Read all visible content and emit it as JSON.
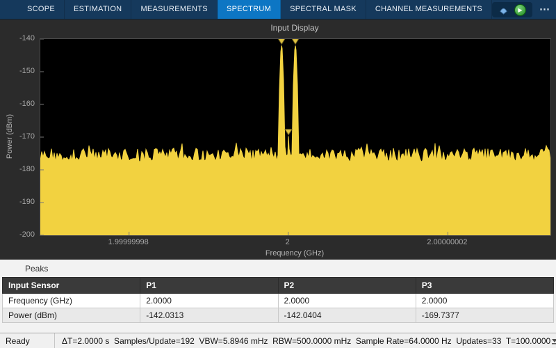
{
  "toolbar": {
    "tabs": [
      {
        "label": "SCOPE",
        "active": false
      },
      {
        "label": "ESTIMATION",
        "active": false
      },
      {
        "label": "MEASUREMENTS",
        "active": false
      },
      {
        "label": "SPECTRUM",
        "active": true
      },
      {
        "label": "SPECTRAL MASK",
        "active": false
      },
      {
        "label": "CHANNEL MEASUREMENTS",
        "active": false
      }
    ],
    "run_glyph": "▶",
    "more_glyph": "⋯",
    "accent_color": "#0d76c4",
    "bar_color": "#15395c"
  },
  "chart_data": {
    "type": "line",
    "title": "Input Display",
    "xlabel": "Frequency (GHz)",
    "ylabel": "Power (dBm)",
    "ylim": [
      -200,
      -140
    ],
    "y_ticks": [
      "-140",
      "-150",
      "-160",
      "-170",
      "-180",
      "-190",
      "-200"
    ],
    "x_ticks": [
      {
        "label": "1.99999998",
        "rel": 0.174
      },
      {
        "label": "2",
        "rel": 0.486
      },
      {
        "label": "2.00000002",
        "rel": 0.799
      }
    ],
    "noise_floor_dbm": -176,
    "peaks": [
      {
        "id": "P1",
        "freq_ghz": "2.0000",
        "power_dbm": -142.0313,
        "rel_x": 0.473,
        "narrow": false
      },
      {
        "id": "P2",
        "freq_ghz": "2.0000",
        "power_dbm": -142.0404,
        "rel_x": 0.5,
        "narrow": false
      },
      {
        "id": "P3",
        "freq_ghz": "2.0000",
        "power_dbm": -169.7377,
        "rel_x": 0.4865,
        "narrow": true
      }
    ],
    "trace_color": "#f2d240",
    "marker_color": "#dcbf40",
    "plot_bg": "#000000",
    "grid": false,
    "legend": "none"
  },
  "peaks_panel": {
    "title": "Peaks",
    "columns": [
      "Input Sensor",
      "P1",
      "P2",
      "P3"
    ],
    "rows": [
      {
        "label": "Frequency (GHz)",
        "values": [
          "2.0000",
          "2.0000",
          "2.0000"
        ]
      },
      {
        "label": "Power (dBm)",
        "values": [
          "-142.0313",
          "-142.0404",
          "-169.7377"
        ]
      }
    ]
  },
  "status_bar": {
    "status": "Ready",
    "stats": "ΔT=2.0000 s  Samples/Update=192  VBW=5.8946 mHz  RBW=500.0000 mHz  Sample Rate=64.0000 Hz  Updates=33  T=100.0000"
  }
}
